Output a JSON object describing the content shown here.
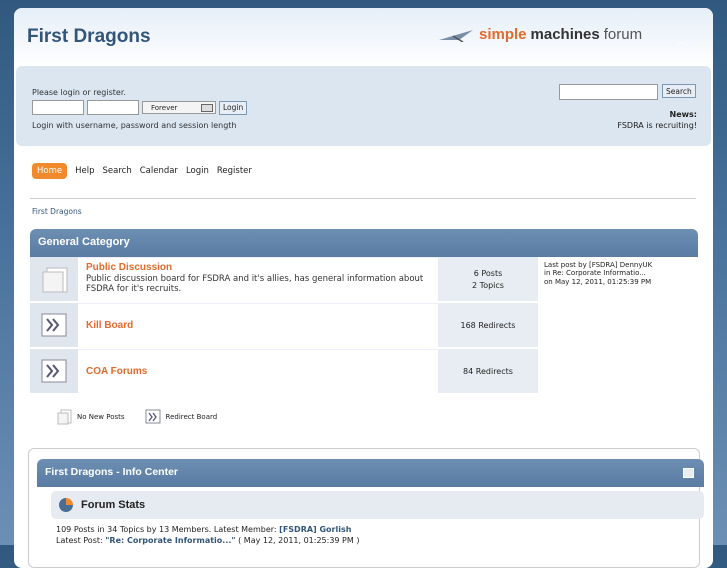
{
  "header": {
    "forum_title": "First Dragons",
    "logo_simple": "simple",
    "logo_machines": "machines",
    "logo_forum": "forum"
  },
  "login": {
    "prompt": "Please login or register.",
    "duration": "Forever",
    "login_button": "Login",
    "hint": "Login with username, password and session length"
  },
  "search": {
    "button": "Search"
  },
  "news": {
    "title": "News:",
    "text": "FSDRA is recruiting!"
  },
  "menu": {
    "items": [
      "Home",
      "Help",
      "Search",
      "Calendar",
      "Login",
      "Register"
    ]
  },
  "breadcrumb": "First Dragons",
  "category": {
    "title": "General Category",
    "boards": [
      {
        "name": "Public Discussion",
        "desc": "Public discussion board for FSDRA and it's allies, has general information about FSDRA for it's recruits.",
        "posts": "6 Posts",
        "topics": "2 Topics",
        "last_by": "Last post by [FSDRA] DennyUK",
        "last_in": "in Re: Corporate Informatio...",
        "last_on": "on May 12, 2011, 01:25:39 PM"
      },
      {
        "name": "Kill Board",
        "redirects": "168 Redirects"
      },
      {
        "name": "COA Forums",
        "redirects": "84 Redirects"
      }
    ]
  },
  "legend": {
    "no_new": "No New Posts",
    "redirect": "Redirect Board"
  },
  "info_center": {
    "title": "First Dragons - Info Center",
    "stats_title": "Forum Stats",
    "line1_prefix": "109 Posts in 34 Topics by 13 Members. Latest Member: ",
    "latest_member": "[FSDRA] Gorlish",
    "line2_prefix": "Latest Post: ",
    "latest_post": "\"Re: Corporate Informatio...\"",
    "line2_suffix": " ( May 12, 2011, 01:25:39 PM )"
  }
}
